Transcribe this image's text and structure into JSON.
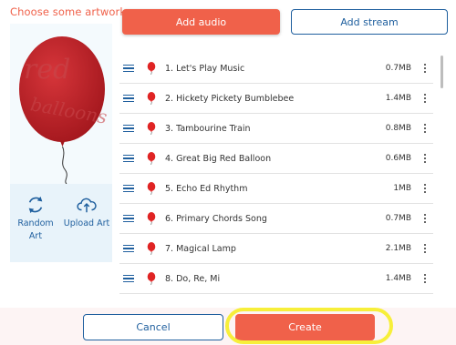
{
  "artwork": {
    "title": "Choose some artwork",
    "image_text": "red balloons",
    "random_label_line1": "Random",
    "random_label_line2": "Art",
    "upload_label": "Upload Art"
  },
  "actions": {
    "add_audio": "Add audio",
    "add_stream": "Add stream"
  },
  "tracks": [
    {
      "name": "1. Let's Play Music",
      "size": "0.7MB"
    },
    {
      "name": "2. Hickety Pickety Bumblebee",
      "size": "1.4MB"
    },
    {
      "name": "3. Tambourine Train",
      "size": "0.8MB"
    },
    {
      "name": "4. Great Big Red Balloon",
      "size": "0.6MB"
    },
    {
      "name": "5. Echo Ed Rhythm",
      "size": "1MB"
    },
    {
      "name": "6. Primary Chords Song",
      "size": "0.7MB"
    },
    {
      "name": "7. Magical Lamp",
      "size": "2.1MB"
    },
    {
      "name": "8. Do, Re, Mi",
      "size": "1.4MB"
    }
  ],
  "footer": {
    "cancel": "Cancel",
    "create": "Create"
  },
  "colors": {
    "accent": "#f0614a",
    "brand_blue": "#1f5f9e",
    "highlight": "#f7ef3a"
  },
  "icons": {
    "drag": "drag-handle-icon",
    "balloon": "balloon-icon",
    "menu": "more-vert-icon",
    "random": "refresh-icon",
    "upload": "cloud-upload-icon"
  }
}
